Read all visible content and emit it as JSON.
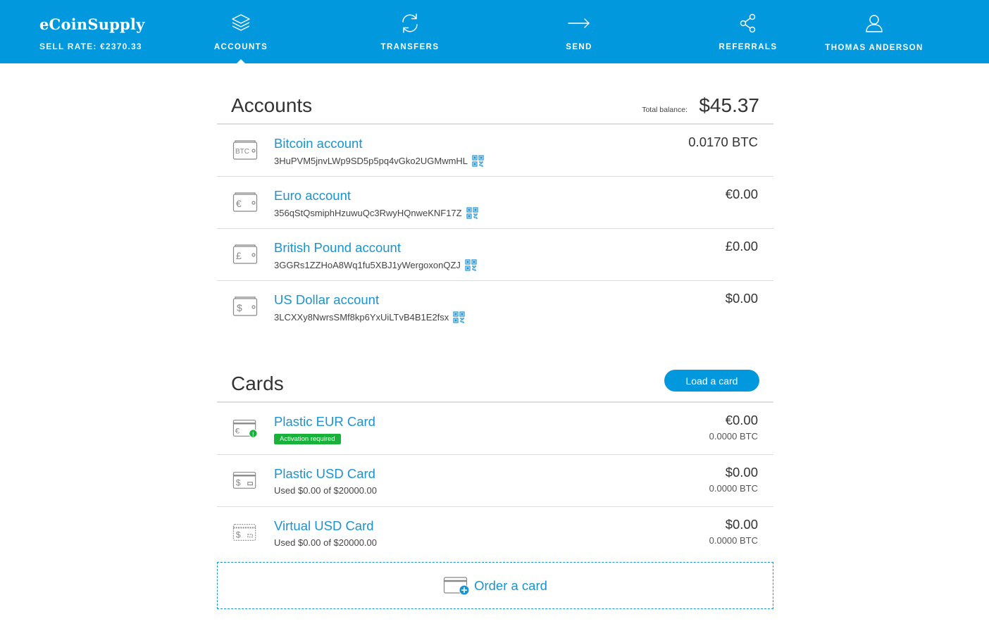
{
  "header": {
    "brand": "eCoinSupply",
    "sell_rate": "SELL RATE: €2370.33",
    "nav": [
      {
        "label": "ACCOUNTS",
        "icon": "layers-icon",
        "active": true
      },
      {
        "label": "TRANSFERS",
        "icon": "refresh-icon"
      },
      {
        "label": "SEND",
        "icon": "arrow-right-icon"
      },
      {
        "label": "REFERRALS",
        "icon": "share-icon"
      },
      {
        "label": "THOMAS ANDERSON",
        "icon": "user-icon"
      }
    ]
  },
  "accounts": {
    "title": "Accounts",
    "total_label": "Total balance:",
    "total_value": "$45.37",
    "items": [
      {
        "name": "Bitcoin account",
        "address": "3HuPVM5jnvLWp9SD5p5pq4vGko2UGMwmHL",
        "amount": "0.0170 BTC",
        "icon": "btc-wallet-icon",
        "icon_symbol": "BTC"
      },
      {
        "name": "Euro account",
        "address": "356qStQsmiphHzuwuQc3RwyHQnweKNF17Z",
        "amount": "€0.00",
        "icon": "euro-wallet-icon",
        "icon_symbol": "€"
      },
      {
        "name": "British Pound account",
        "address": "3GGRs1ZZHoA8Wq1fu5XBJ1yWergoxonQZJ",
        "amount": "£0.00",
        "icon": "pound-wallet-icon",
        "icon_symbol": "£"
      },
      {
        "name": "US Dollar account",
        "address": "3LCXXy8NwrsSMf8kp6YxUiLTvB4B1E2fsx",
        "amount": "$0.00",
        "icon": "dollar-wallet-icon",
        "icon_symbol": "$"
      }
    ]
  },
  "cards": {
    "title": "Cards",
    "load_button": "Load a card",
    "items": [
      {
        "name": "Plastic EUR Card",
        "badge": "Activation required",
        "amount": "€0.00",
        "btc": "0.0000 BTC",
        "icon": "euro-card-icon",
        "icon_symbol": "€"
      },
      {
        "name": "Plastic USD Card",
        "sub": "Used $0.00 of $20000.00",
        "amount": "$0.00",
        "btc": "0.0000 BTC",
        "icon": "dollar-card-icon",
        "icon_symbol": "$"
      },
      {
        "name": "Virtual USD Card",
        "sub": "Used $0.00 of $20000.00",
        "amount": "$0.00",
        "btc": "0.0000 BTC",
        "icon": "virtual-dollar-card-icon",
        "icon_symbol": "$"
      }
    ],
    "order_label": "Order a card"
  },
  "colors": {
    "brand_blue": "#0298dd",
    "link_blue": "#1b93d1",
    "badge_green": "#18b23b"
  }
}
